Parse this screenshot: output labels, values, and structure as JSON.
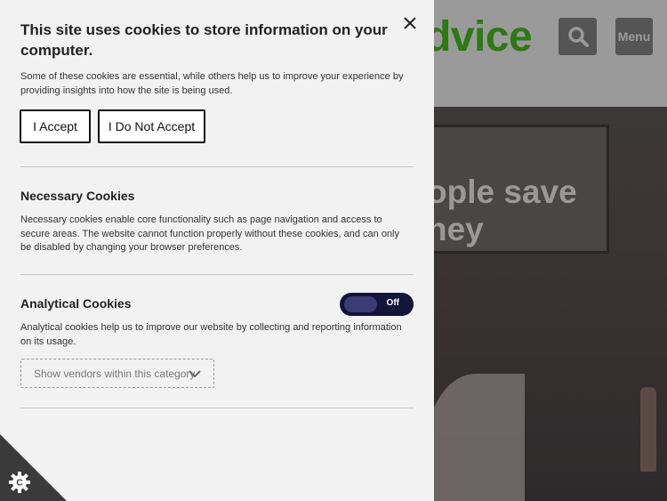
{
  "site": {
    "logo_text": "dvice",
    "menu_label": "Menu",
    "hero_line1": "ople save",
    "hero_line2": "ney"
  },
  "cookie_panel": {
    "title": "This site uses cookies to store information on your computer.",
    "intro": "Some of these cookies are essential, while others help us to improve your experience by providing insights into how the site is being used.",
    "accept_label": "I Accept",
    "decline_label": "I Do Not Accept",
    "necessary": {
      "title": "Necessary Cookies",
      "text": "Necessary cookies enable core functionality such as page navigation and access to secure areas. The website cannot function properly without these cookies, and can only be disabled by changing your browser preferences."
    },
    "analytical": {
      "title": "Analytical Cookies",
      "toggle_label": "Off",
      "text": "Analytical cookies help us to improve our website by collecting and reporting information on its usage.",
      "vendors_label": "Show vendors within this category"
    }
  },
  "colors": {
    "panel_bg": "#f2f2f2",
    "toggle_bg": "#14143a",
    "logo_green": "#2b7a12"
  },
  "icons": {
    "close": "close-icon",
    "search": "search-icon",
    "chevron": "chevron-down-icon",
    "cookie_control": "cookie-control-icon"
  }
}
